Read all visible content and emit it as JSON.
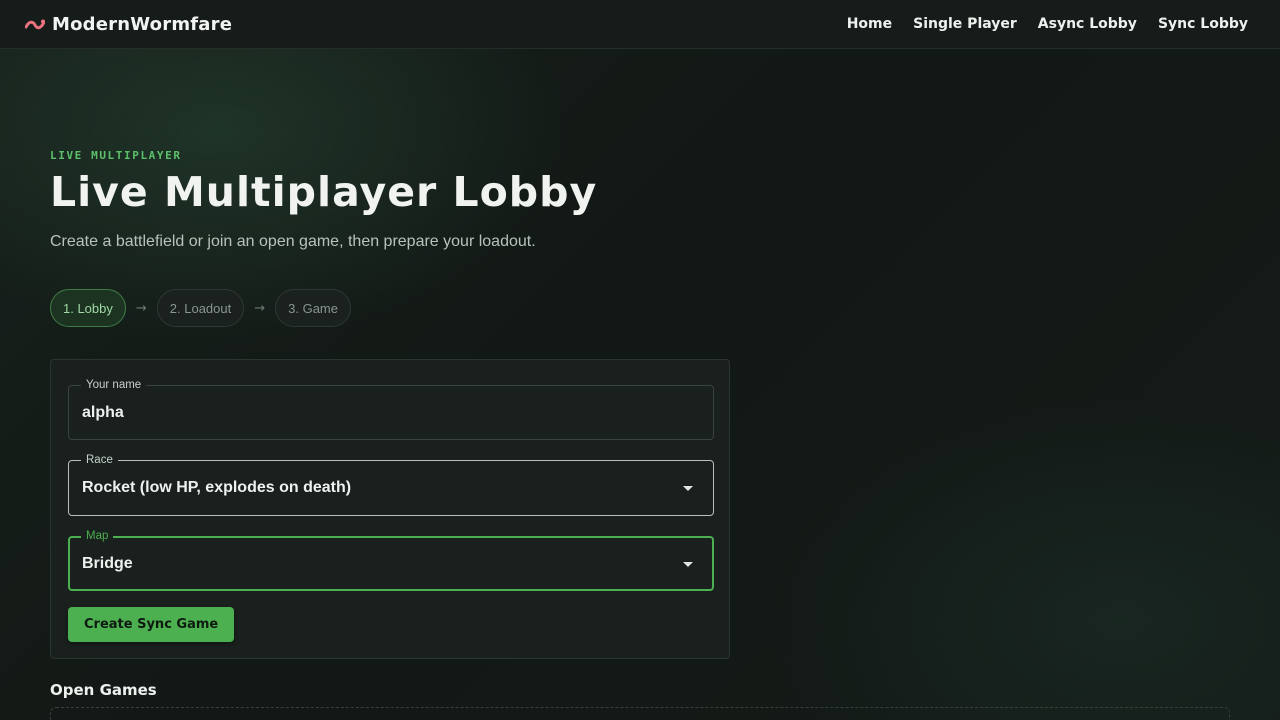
{
  "brand": {
    "name": "ModernWormfare",
    "accent": "#e8737f"
  },
  "nav": {
    "items": [
      {
        "label": "Home"
      },
      {
        "label": "Single Player"
      },
      {
        "label": "Async Lobby"
      },
      {
        "label": "Sync Lobby"
      }
    ]
  },
  "hero": {
    "eyebrow": "LIVE MULTIPLAYER",
    "title": "Live Multiplayer Lobby",
    "subtitle": "Create a battlefield or join an open game, then prepare your loadout."
  },
  "steps": {
    "items": [
      {
        "label": "1. Lobby",
        "active": true
      },
      {
        "label": "2. Loadout",
        "active": false
      },
      {
        "label": "3. Game",
        "active": false
      }
    ],
    "separator": "→"
  },
  "form": {
    "name": {
      "label": "Your name",
      "value": "alpha"
    },
    "race": {
      "label": "Race",
      "value": "Rocket (low HP, explodes on death)"
    },
    "map": {
      "label": "Map",
      "value": "Bridge"
    },
    "create_label": "Create Sync Game"
  },
  "open_games": {
    "heading": "Open Games"
  },
  "colors": {
    "accent_green": "#4caf50",
    "eyebrow_green": "#5cc06a",
    "background": "#131916"
  }
}
